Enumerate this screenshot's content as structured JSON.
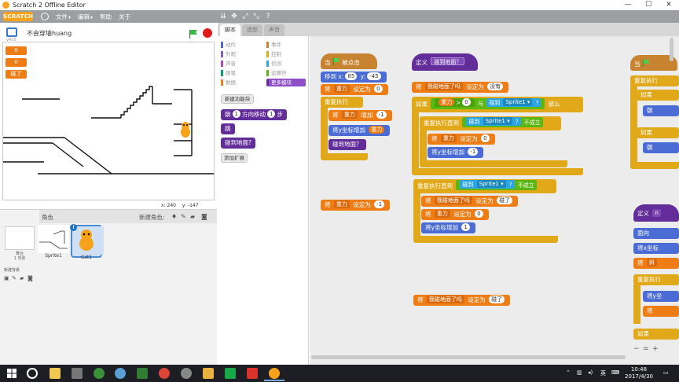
{
  "window": {
    "title": "Scratch 2 Offline Editor",
    "minimize": "—",
    "maximize": "☐",
    "close": "✕"
  },
  "menubar": {
    "logo": "SCRATCH",
    "menus": [
      {
        "label": "文件",
        "caret": "▾"
      },
      {
        "label": "编辑",
        "caret": "▾"
      },
      {
        "label": "帮助"
      },
      {
        "label": "关于"
      }
    ],
    "tools": [
      "⇊",
      "✥",
      "⤢",
      "⤡",
      "?"
    ]
  },
  "stage": {
    "version": "v455",
    "project_name": "不会穿墙huang",
    "variables": [
      "0",
      "0",
      "碰了"
    ],
    "coords": {
      "x_label": "x:",
      "x": "240",
      "y_label": "y:",
      "y": "-147"
    }
  },
  "sprite_pane": {
    "title": "角色",
    "new_sprite_label": "新建角色:",
    "stage_label": "舞台",
    "stage_sub": "1 背景",
    "new_backdrop_label": "新建背景",
    "sprites": [
      {
        "name": "Sprite1",
        "selected": false
      },
      {
        "name": "Cat1",
        "selected": true
      }
    ],
    "info": "i"
  },
  "tabs": [
    {
      "label": "脚本",
      "active": true
    },
    {
      "label": "造型",
      "active": false
    },
    {
      "label": "声音",
      "active": false
    }
  ],
  "palette": {
    "categories_left": [
      {
        "label": "动作",
        "color": "#4a6cd4"
      },
      {
        "label": "外观",
        "color": "#8a55d7"
      },
      {
        "label": "声音",
        "color": "#bb42c3"
      },
      {
        "label": "画笔",
        "color": "#0e9a6c"
      },
      {
        "label": "数据",
        "color": "#ee7d16"
      }
    ],
    "categories_right": [
      {
        "label": "事件",
        "color": "#c88330"
      },
      {
        "label": "控制",
        "color": "#e1a91a"
      },
      {
        "label": "侦测",
        "color": "#2ca5e2"
      },
      {
        "label": "运算符",
        "color": "#5cb712"
      },
      {
        "label": "更多模块",
        "color": "#632d99",
        "selected": true
      }
    ],
    "make_block": "新建功能块",
    "custom_block": {
      "pre": "朝",
      "a": "1",
      "mid": "方向移动",
      "b": "1",
      "post": "步"
    },
    "jump_block": "跳",
    "touch_block": "碰到地面?",
    "add_extension": "添加扩展"
  },
  "scripts": {
    "s1": {
      "hat_when": "当",
      "hat_clicked": "被点击",
      "goto": {
        "label": "移到",
        "x_label": "x:",
        "x": "85",
        "y_label": "y:",
        "y": "-45"
      },
      "set_gravity": {
        "label": "将",
        "var": "重力",
        "mid": "设定为",
        "val": "0"
      },
      "forever": "重复执行",
      "change_gravity": {
        "label": "将",
        "var": "重力",
        "mid": "增加",
        "val": "-1"
      },
      "change_y": {
        "label": "将y坐标增加",
        "var": "重力"
      },
      "touch": "碰到地面？"
    },
    "loose_set": {
      "label": "将",
      "var": "重力",
      "mid": "设定为",
      "val": "-1"
    },
    "s2": {
      "define": "定义",
      "define_name": "碰到地面？",
      "set_touched": {
        "label": "将",
        "var": "我碰地面了吗",
        "mid": "设定为",
        "val": "没有"
      },
      "if_label": "如果",
      "cond_var": "重力",
      "gt": ">",
      "cond_val": "0",
      "and": "与",
      "touching": "碰到",
      "sprite": "Sprite1",
      "q": "?",
      "then": "那么",
      "repeat_until": "重复执行直到",
      "not_hold": "不成立",
      "set_gravity0": {
        "label": "将",
        "var": "重力",
        "mid": "设定为",
        "val": "0"
      },
      "change_y_neg": {
        "label": "将y坐标增加",
        "val": "-1"
      },
      "repeat_until2": "重复执行直到",
      "set_touched2": {
        "label": "将",
        "var": "我碰地面了吗",
        "mid": "设定为",
        "val": "碰了"
      },
      "set_gravity0b": {
        "label": "将",
        "var": "重力",
        "mid": "设定为",
        "val": "0"
      },
      "change_y_pos": {
        "label": "将y坐标增加",
        "val": "1"
      }
    },
    "loose_set2": {
      "label": "将",
      "var": "我碰地面了吗",
      "mid": "设定为",
      "val": "碰了"
    },
    "right": {
      "hat_when": "当",
      "forever": "重复执行",
      "if1": "如果",
      "face1": "朝",
      "if2": "如果",
      "face2": "朝",
      "define": "定义",
      "define_arg": "n",
      "point": "面向",
      "change_x": "将x坐标",
      "set": "将",
      "set_var": "斜",
      "forever2": "重复执行",
      "change_y": "将y坐",
      "set2": "将",
      "if3": "如果"
    }
  },
  "zoom": [
    "−",
    "=",
    "+"
  ],
  "taskbar": {
    "tray_ime": "英",
    "time": "10:48",
    "date": "2017/4/30",
    "notif": "▭"
  }
}
